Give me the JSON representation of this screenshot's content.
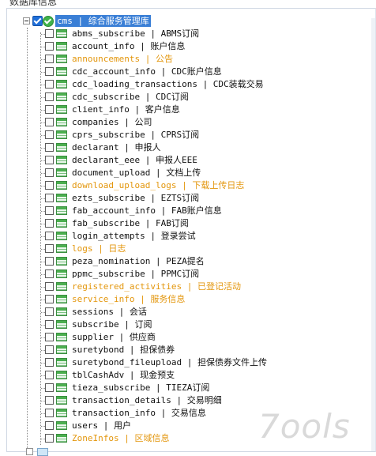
{
  "panel": {
    "title": "数据库信息"
  },
  "root": {
    "label": "cms  |  综合服务管理库"
  },
  "tables": [
    {
      "label": "abms_subscribe  |  ABMS订阅",
      "highlight": false
    },
    {
      "label": "account_info  |  账户信息",
      "highlight": false
    },
    {
      "label": "announcements  |  公告",
      "highlight": true
    },
    {
      "label": "cdc_account_info  |  CDC账户信息",
      "highlight": false
    },
    {
      "label": "cdc_loading_transactions  |  CDC装载交易",
      "highlight": false
    },
    {
      "label": "cdc_subscribe  |  CDC订阅",
      "highlight": false
    },
    {
      "label": "client_info  |  客户信息",
      "highlight": false
    },
    {
      "label": "companies  |  公司",
      "highlight": false
    },
    {
      "label": "cprs_subscribe  |  CPRS订阅",
      "highlight": false
    },
    {
      "label": "declarant  |  申报人",
      "highlight": false
    },
    {
      "label": "declarant_eee  |  申报人EEE",
      "highlight": false
    },
    {
      "label": "document_upload  |  文档上传",
      "highlight": false
    },
    {
      "label": "download_upload_logs  |  下载上传日志",
      "highlight": true
    },
    {
      "label": "ezts_subscribe  |  EZTS订阅",
      "highlight": false
    },
    {
      "label": "fab_account_info  |  FAB账户信息",
      "highlight": false
    },
    {
      "label": "fab_subscribe  |  FAB订阅",
      "highlight": false
    },
    {
      "label": "login_attempts  |  登录尝试",
      "highlight": false
    },
    {
      "label": "logs  |  日志",
      "highlight": true
    },
    {
      "label": "peza_nomination  |  PEZA提名",
      "highlight": false
    },
    {
      "label": "ppmc_subscribe  |  PPMC订阅",
      "highlight": false
    },
    {
      "label": "registered_activities  |  已登记活动",
      "highlight": true
    },
    {
      "label": "service_info  |  服务信息",
      "highlight": true
    },
    {
      "label": "sessions  |  会话",
      "highlight": false
    },
    {
      "label": "subscribe  |  订阅",
      "highlight": false
    },
    {
      "label": "supplier  |  供应商",
      "highlight": false
    },
    {
      "label": "suretybond  |  担保债券",
      "highlight": false
    },
    {
      "label": "suretybond_fileupload  |  担保债券文件上传",
      "highlight": false
    },
    {
      "label": "tblCashAdv  |  现金预支",
      "highlight": false
    },
    {
      "label": "tieza_subscribe  |  TIEZA订阅",
      "highlight": false
    },
    {
      "label": "transaction_details  |  交易明细",
      "highlight": false
    },
    {
      "label": "transaction_info  |  交易信息",
      "highlight": false
    },
    {
      "label": "users  |  用户",
      "highlight": false
    },
    {
      "label": "ZoneInfos  |  区域信息",
      "highlight": true
    }
  ],
  "colors": {
    "highlight": "#e3960c",
    "selection": "#3a7fd6"
  },
  "watermark": "7ools"
}
